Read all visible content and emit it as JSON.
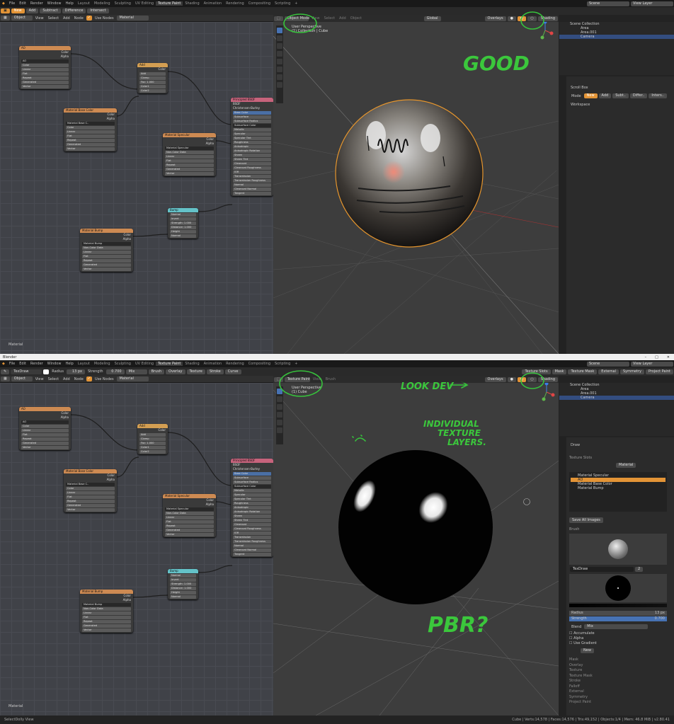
{
  "top": {
    "menu": [
      "File",
      "Edit",
      "Render",
      "Window",
      "Help"
    ],
    "workspace_tabs": [
      "Layout",
      "Modeling",
      "Sculpting",
      "UV Editing",
      "Texture Paint",
      "Shading",
      "Animation",
      "Rendering",
      "Compositing",
      "Scripting",
      "+"
    ],
    "active_tab": "Texture Paint",
    "scene": "Scene",
    "view_layer": "View Layer",
    "tool_header": {
      "mode_buttons": [
        "New",
        "Add",
        "Subtract",
        "Difference",
        "Intersect"
      ],
      "active": "New"
    },
    "node_header": {
      "object": "Object",
      "menus": [
        "View",
        "Select",
        "Add",
        "Node"
      ],
      "use_nodes": "Use Nodes",
      "slot": "Material"
    },
    "viewport": {
      "mode": "Object Mode",
      "menus": [
        "View",
        "Select",
        "Add",
        "Object"
      ],
      "orientation": "Global",
      "overlays": "Overlays",
      "shading": "Shading",
      "text_line1": "User Perspective",
      "text_line2": "(1) Collection | Cube"
    },
    "annotation": "GOOD",
    "outliner": {
      "title": "Scene Collection",
      "items": [
        "Area",
        "Area.001",
        "Camera",
        ""
      ]
    },
    "properties": {
      "tool": "Scroll Box",
      "mode_label": "Mode",
      "buttons": [
        "New",
        "Add",
        "Subt..",
        "Differ..",
        "Inters.."
      ],
      "section": "Workspace"
    },
    "material_label": "Material"
  },
  "nodes": {
    "ao": {
      "title": "AO",
      "outputs": [
        "Color",
        "Alpha"
      ],
      "fields": [
        "AO",
        "Color",
        "Linear",
        "Flat",
        "Repeat",
        "Generated",
        "Vector"
      ]
    },
    "add": {
      "title": "Add",
      "outputs": [
        "Color"
      ],
      "fields": [
        "Add",
        "Clamp",
        "Fac: 1.000",
        "Color1",
        "Color2"
      ]
    },
    "base": {
      "title": "Material Base Color",
      "outputs": [
        "Color",
        "Alpha"
      ],
      "fields": [
        "Material Base C..",
        "Color",
        "Linear",
        "Flat",
        "Repeat",
        "Generated",
        "Vector"
      ]
    },
    "spec": {
      "title": "Material Specular",
      "outputs": [
        "Color",
        "Alpha"
      ],
      "fields": [
        "Material Specular",
        "Non-Color Data",
        "Linear",
        "Flat",
        "Repeat",
        "Generated",
        "Vector"
      ]
    },
    "bsdf": {
      "title": "Principled BSDF",
      "fields": [
        "BSDF",
        "Christensen-Burley",
        "Base Color",
        "Subsurface",
        "Subsurface Radius",
        "Subsurface Color",
        "Metallic",
        "Specular",
        "Specular Tint",
        "Roughness",
        "Anisotropic",
        "Anisotropic Rotation",
        "Sheen",
        "Sheen Tint",
        "Clearcoat",
        "Clearcoat Roughness",
        "IOR",
        "Transmission",
        "Transmission Roughness",
        "Normal",
        "Clearcoat Normal",
        "Tangent"
      ]
    },
    "bump": {
      "title": "Bump",
      "fields": [
        "Normal",
        "Invert",
        "Strength: 1.000",
        "Distance: 1.000",
        "Height",
        "Normal"
      ]
    },
    "mbump": {
      "title": "Material Bump",
      "outputs": [
        "Color",
        "Alpha"
      ],
      "fields": [
        "Material Bump",
        "Non-Color Data",
        "Linear",
        "Flat",
        "Repeat",
        "Generated",
        "Vector"
      ]
    }
  },
  "bottom": {
    "window_title": "Blender",
    "menu": [
      "File",
      "Edit",
      "Render",
      "Window",
      "Help"
    ],
    "workspace_tabs": [
      "Layout",
      "Modeling",
      "Sculpting",
      "UV Editing",
      "Texture Paint",
      "Shading",
      "Animation",
      "Rendering",
      "Compositing",
      "Scripting",
      "+"
    ],
    "active_tab": "Texture Paint",
    "scene": "Scene",
    "view_layer": "View Layer",
    "tool_header": {
      "brush": "TexDraw",
      "radius_label": "Radius",
      "radius": "13 px",
      "strength_label": "Strength",
      "strength": "0.700",
      "blend": "Mix",
      "menus": [
        "Brush",
        "Overlay",
        "Texture",
        "Stroke",
        "Curve"
      ],
      "right": [
        "Texture Slots",
        "Mask",
        "Texture Mask",
        "External",
        "Symmetry",
        "Project Paint"
      ]
    },
    "node_header": {
      "object": "Object",
      "menus": [
        "View",
        "Select",
        "Add",
        "Node"
      ],
      "use_nodes": "Use Nodes",
      "slot": "Material"
    },
    "viewport": {
      "mode": "Texture Paint",
      "menus": [
        "View",
        "Brush"
      ],
      "overlays": "Overlays",
      "shading": "Shading",
      "text_line1": "User Perspective",
      "text_line2": "(1) Cube"
    },
    "annotations": [
      "LOOK DEV",
      "INDIVIDUAL",
      "TEXTURE",
      "LAYERS.",
      "PBR?"
    ],
    "outliner": {
      "title": "Scene Collection",
      "items": [
        "Area",
        "Area.001",
        "Camera",
        ""
      ]
    },
    "properties": {
      "tool": "Draw",
      "texture_slots_header": "Texture Slots",
      "mode_value": "Material",
      "slots": [
        "Material Specular",
        "AO",
        "Material Base Color",
        "Material Bump"
      ],
      "active_slot": 1,
      "save_all": "Save All Images",
      "brush_header": "Brush",
      "brush_name": "TexDraw",
      "brush_users": "2",
      "radius_label": "Radius",
      "radius": "13 px",
      "strength_label": "Strength",
      "strength": "0.700",
      "blend_label": "Blend",
      "blend": "Mix",
      "checks": [
        "Accumulate",
        "Alpha",
        "Use Gradient"
      ],
      "new_label": "New",
      "panels": [
        "Mask",
        "Overlay",
        "Texture",
        "Texture Mask",
        "Stroke",
        "Falloff",
        "External",
        "Symmetry",
        "Project Paint"
      ]
    },
    "material_label": "Material"
  },
  "status": {
    "left": "Select",
    "middle": "Dolly View",
    "right": "Cube | Verts:14,578 | Faces:14,576 | Tris:49,152 | Objects:1/4 | Mem: 46.8 MiB | v2.80.41"
  },
  "colors": {
    "accent": "#e39436",
    "annotation": "#37c23c",
    "select_blue": "#4772b3"
  }
}
